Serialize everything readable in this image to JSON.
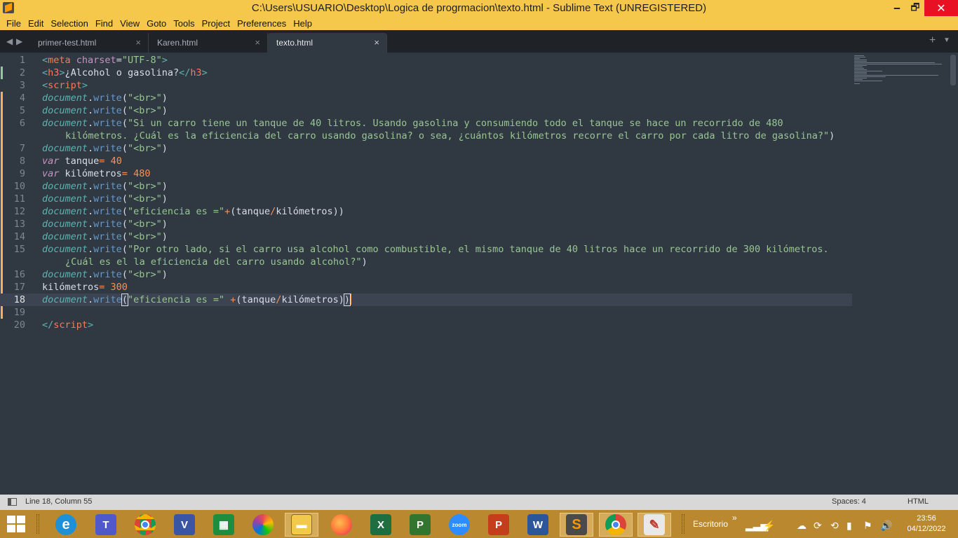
{
  "window": {
    "title": "C:\\Users\\USUARIO\\Desktop\\Logica de progrmacion\\texto.html - Sublime Text (UNREGISTERED)",
    "minimize": "🗕",
    "maximize": "🗗",
    "close": "✕"
  },
  "menu": [
    "File",
    "Edit",
    "Selection",
    "Find",
    "View",
    "Goto",
    "Tools",
    "Project",
    "Preferences",
    "Help"
  ],
  "tabs": [
    {
      "label": "primer-test.html",
      "close": "×"
    },
    {
      "label": "Karen.html",
      "close": "×"
    },
    {
      "label": "texto.html",
      "close": "×"
    }
  ],
  "tab_controls": {
    "prev": "◀",
    "next": "▶",
    "new": "+",
    "dropdown": "▼"
  },
  "editor": {
    "current_line": 18,
    "line_numbers": [
      "1",
      "2",
      "3",
      "4",
      "5",
      "6",
      "",
      "7",
      "8",
      "9",
      "10",
      "11",
      "12",
      "13",
      "14",
      "15",
      "",
      "16",
      "17",
      "18",
      "19",
      "20"
    ],
    "lines": {
      "l1": {
        "open": "<",
        "tag": "meta",
        "attr": " charset",
        "eq": "=",
        "val": "\"UTF-8\"",
        "close": ">"
      },
      "l2": {
        "open": "<",
        "tag": "h3",
        "close1": ">",
        "text": "¿Alcohol o gasolina?",
        "open2": "</",
        "tag2": "h3",
        "close2": ">"
      },
      "l3": {
        "open": "<",
        "tag": "script",
        "close": ">"
      },
      "doc": "document",
      "write": "write",
      "br": "\"<br>\"",
      "l6a": "\"Si un carro tiene un tanque de 40 litros. Usando gasolina y consumiendo todo el tanque se hace un recorrido de 480",
      "l6b": "kilómetros. ¿Cuál es la eficiencia del carro usando gasolina? o sea, ¿cuántos kilómetros recorre el carro por cada litro de gasolina?\"",
      "l8": {
        "kw": "var",
        "name": " tanque",
        "op": "=",
        "num": " 40"
      },
      "l9": {
        "kw": "var",
        "name": " kilómetros",
        "op": "=",
        "num": " 480"
      },
      "l12": {
        "str": "\"eficiencia es =\"",
        "op": "+",
        "p1": "(tanque",
        "div": "/",
        "p2": "kilómetros))"
      },
      "l15a": "\"Por otro lado, si el carro usa alcohol como combustible, el mismo tanque de 40 litros hace un recorrido de 300 kilómetros.",
      "l15b": "¿Cuál es el la eficiencia del carro usando alcohol?\"",
      "l17": {
        "name": "kilómetros",
        "op": "=",
        "num": " 300"
      },
      "l18": {
        "str": "\"eficiencia es =\"",
        "op": " +",
        "p1": "(tanque",
        "div": "/",
        "p2": "kilómetros)",
        "p3": ")"
      },
      "l20": {
        "open": "</",
        "tag": "script",
        "close": ">"
      }
    }
  },
  "status": {
    "position": "Line 18, Column 55",
    "spaces": "Spaces: 4",
    "syntax": "HTML"
  },
  "taskbar": {
    "tray_label": "Escritorio",
    "tray_chevron": "»",
    "time": "23:56",
    "date": "04/12/2022",
    "apps": [
      "windows-start",
      "internet-explorer",
      "teams",
      "chrome",
      "visio",
      "excel-store",
      "paint-3d",
      "file-explorer",
      "firefox",
      "excel",
      "project",
      "zoom",
      "powerpoint",
      "word",
      "sublime-text",
      "chrome-profile",
      "paint"
    ]
  },
  "colors": {
    "title_bar": "#F5C84C",
    "editor_bg": "#303841",
    "tab_bar": "#1F2227",
    "taskbar": "#B9882F",
    "modified_marker": "#F9AE58",
    "added_marker": "#99C794"
  }
}
